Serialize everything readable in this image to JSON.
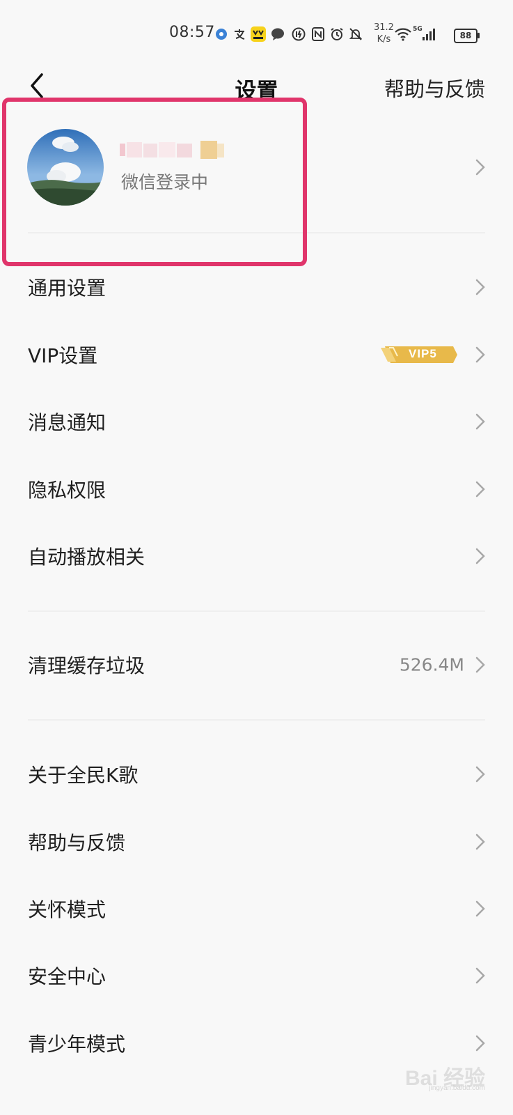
{
  "status_bar": {
    "time": "08:57",
    "net_speed_value": "31.2",
    "net_speed_unit": "K/s",
    "network_type": "5G",
    "battery": "88"
  },
  "nav": {
    "title": "设置",
    "help_label": "帮助与反馈"
  },
  "profile": {
    "login_status": "微信登录中"
  },
  "settings_groups": {
    "general": "通用设置",
    "vip": "VIP设置",
    "vip_badge": "VIP5",
    "notifications": "消息通知",
    "privacy": "隐私权限",
    "autoplay": "自动播放相关",
    "clear_cache": "清理缓存垃圾",
    "cache_size": "526.4M",
    "about": "关于全民K歌",
    "help": "帮助与反馈",
    "care_mode": "关怀模式",
    "security": "安全中心",
    "teen_mode": "青少年模式"
  },
  "colors": {
    "highlight_border": "#e0356b",
    "background": "#f8f8f8",
    "vip_gold": "#e8b94a"
  },
  "watermark": {
    "text": "Bai 经验",
    "sub": "jingyan.baidu.com"
  }
}
